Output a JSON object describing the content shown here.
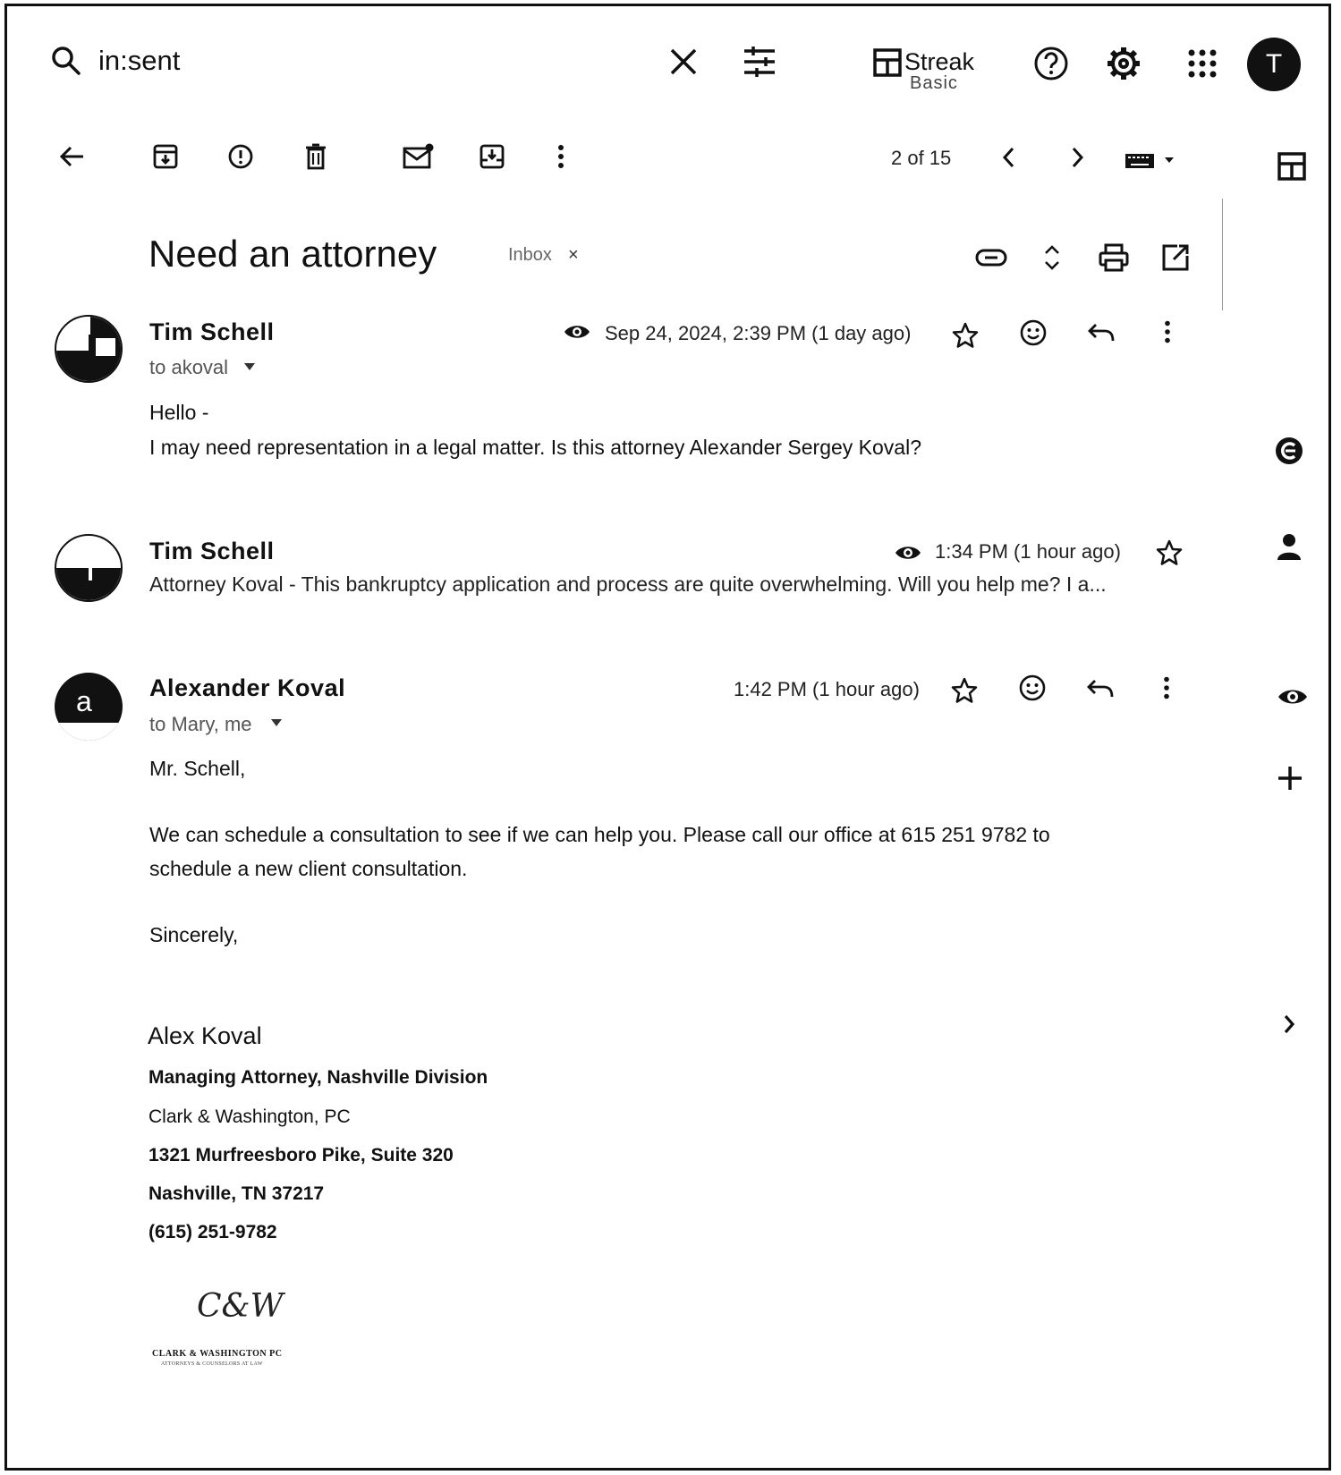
{
  "search": {
    "query": "in:sent"
  },
  "header": {
    "streak_name": "Streak",
    "streak_plan": "Basic",
    "account_initial": "T"
  },
  "toolbar": {
    "page_count": "2 of 15"
  },
  "thread": {
    "subject": "Need an attorney",
    "label": "Inbox",
    "label_remove": "×"
  },
  "messages": [
    {
      "sender": "Tim Schell",
      "to": "to akoval",
      "date": "Sep 24, 2024, 2:39 PM (1 day ago)",
      "body": [
        "Hello -",
        "I may need representation in a legal matter.  Is this attorney Alexander Sergey Koval?"
      ]
    },
    {
      "sender": "Tim Schell",
      "date": "1:34 PM (1 hour ago)",
      "snippet": "Attorney Koval - This bankruptcy application and process are quite overwhelming. Will you help me? I a..."
    },
    {
      "sender": "Alexander Koval",
      "avatar_letter": "a",
      "to": "to Mary, me",
      "date": "1:42 PM (1 hour ago)",
      "body": [
        "Mr. Schell,",
        "We can schedule a consultation to see if we can help you. Please call our office at 615 251 9782 to",
        "schedule a new client consultation.",
        "Sincerely,"
      ],
      "signature": {
        "name": "Alex Koval",
        "title": "Managing Attorney, Nashville Division",
        "firm": "Clark & Washington, PC",
        "address1": "1321 Murfreesboro Pike, Suite 320",
        "address2": "Nashville, TN 37217",
        "phone": "(615) 251-9782",
        "logo_mark": "C&W",
        "logo_text": "CLARK & WASHINGTON PC",
        "logo_sub": "ATTORNEYS & COUNSELORS AT LAW"
      }
    }
  ],
  "icons": {
    "search": "search-icon",
    "clear": "close-icon",
    "filters": "tune-icon",
    "streak": "streak-icon",
    "help": "help-icon",
    "settings": "gear-icon",
    "apps": "apps-grid-icon",
    "back": "arrow-left-icon",
    "archive": "archive-icon",
    "spam": "report-icon",
    "delete": "trash-icon",
    "unread": "mark-unread-icon",
    "move": "move-to-icon",
    "more": "more-vert-icon",
    "prev": "chevron-left-icon",
    "next": "chevron-right-icon",
    "keyboard": "keyboard-icon",
    "link": "link-icon",
    "expand": "unfold-icon",
    "print": "print-icon",
    "open": "open-new-window-icon",
    "eye": "eye-icon",
    "star": "star-icon",
    "emoji": "emoji-icon",
    "reply": "reply-icon",
    "streak_side": "streak-panel-icon",
    "contacts": "person-icon",
    "add": "plus-icon",
    "expand_panel": "chevron-right-icon"
  }
}
